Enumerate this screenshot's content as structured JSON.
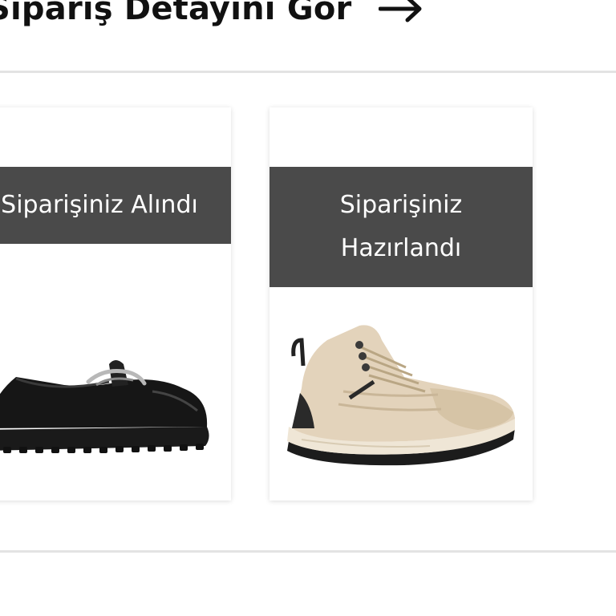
{
  "header": {
    "detail_link_label": "Sipariş Detayini Gör",
    "arrow_icon": "arrow-right-icon"
  },
  "order_items": [
    {
      "status": "Siparişiniz Alındı",
      "product_icon": "black-loafer-image"
    },
    {
      "status": "Siparişiniz Hazırlandı",
      "product_icon": "beige-hiking-boot-image"
    }
  ],
  "colors": {
    "banner": "#4a4a4a",
    "banner_text": "#ffffff",
    "divider": "#e3e3e3",
    "title": "#111111"
  }
}
